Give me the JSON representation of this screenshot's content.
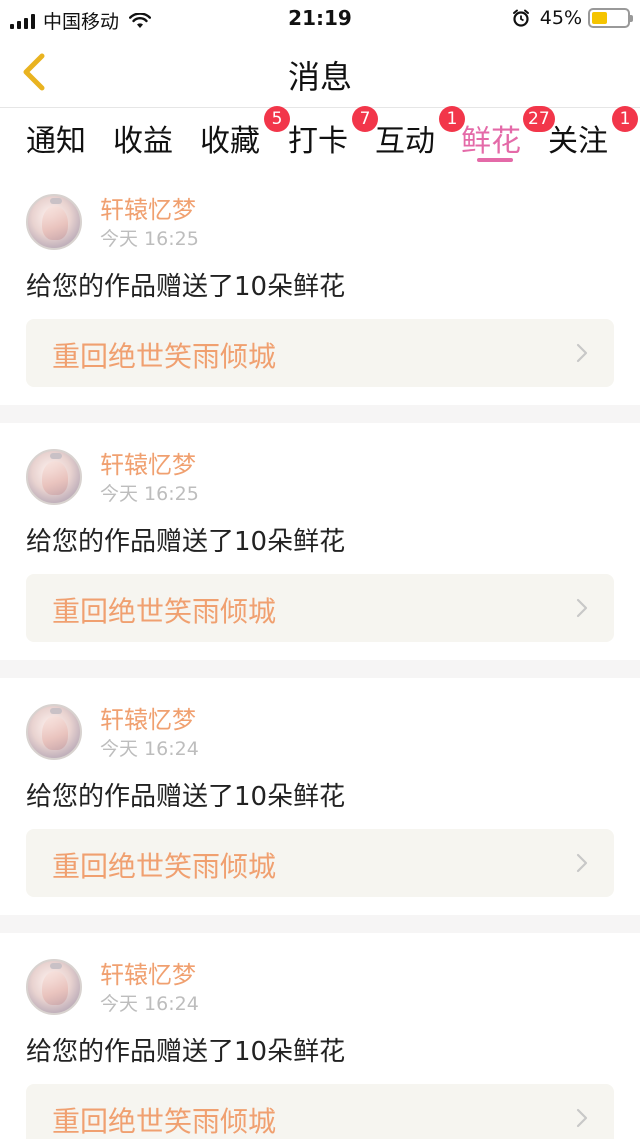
{
  "status": {
    "carrier": "中国移动",
    "time": "21:19",
    "battery": "45%",
    "battery_level": 0.45
  },
  "nav": {
    "title": "消息"
  },
  "tabs": [
    {
      "label": "通知",
      "badge": "",
      "active": false
    },
    {
      "label": "收益",
      "badge": "",
      "active": false
    },
    {
      "label": "收藏",
      "badge": "5",
      "active": false
    },
    {
      "label": "打卡",
      "badge": "7",
      "active": false
    },
    {
      "label": "互动",
      "badge": "1",
      "active": false
    },
    {
      "label": "鲜花",
      "badge": "27",
      "active": true
    },
    {
      "label": "关注",
      "badge": "1",
      "active": false
    }
  ],
  "colors": {
    "accent": "#e46aa8",
    "name": "#f0a070",
    "badge": "#f2364a"
  },
  "messages": [
    {
      "user": "轩辕忆梦",
      "time": "今天 16:25",
      "content": "给您的作品赠送了10朵鲜花",
      "work": "重回绝世笑雨倾城"
    },
    {
      "user": "轩辕忆梦",
      "time": "今天 16:25",
      "content": "给您的作品赠送了10朵鲜花",
      "work": "重回绝世笑雨倾城"
    },
    {
      "user": "轩辕忆梦",
      "time": "今天 16:24",
      "content": "给您的作品赠送了10朵鲜花",
      "work": "重回绝世笑雨倾城"
    },
    {
      "user": "轩辕忆梦",
      "time": "今天 16:24",
      "content": "给您的作品赠送了10朵鲜花",
      "work": "重回绝世笑雨倾城"
    }
  ]
}
